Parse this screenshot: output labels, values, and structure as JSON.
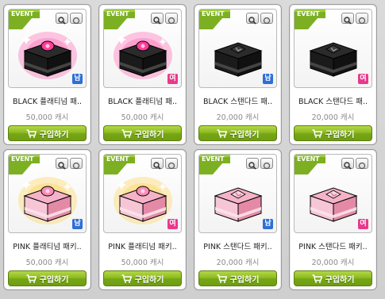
{
  "event_badge": "EVENT",
  "buy_label": "구입하기",
  "items": [
    {
      "name": "BLACK 플래티넘 패..",
      "price": "50,000 캐시",
      "gender": "남",
      "gender_color": "#2f6fd6",
      "color": "black",
      "tier": "platinum"
    },
    {
      "name": "BLACK 플래티넘 패..",
      "price": "50,000 캐시",
      "gender": "여",
      "gender_color": "#e8398d",
      "color": "black",
      "tier": "platinum"
    },
    {
      "name": "BLACK 스탠다드 패..",
      "price": "20,000 캐시",
      "gender": "남",
      "gender_color": "#2f6fd6",
      "color": "black",
      "tier": "standard"
    },
    {
      "name": "BLACK 스탠다드 패..",
      "price": "20,000 캐시",
      "gender": "여",
      "gender_color": "#e8398d",
      "color": "black",
      "tier": "standard"
    },
    {
      "name": "PINK 플래티넘 패키..",
      "price": "50,000 캐시",
      "gender": "남",
      "gender_color": "#2f6fd6",
      "color": "pink",
      "tier": "platinum"
    },
    {
      "name": "PINK 플래티넘 패키..",
      "price": "50,000 캐시",
      "gender": "여",
      "gender_color": "#e8398d",
      "color": "pink",
      "tier": "platinum"
    },
    {
      "name": "PINK 스탠다드 패키..",
      "price": "20,000 캐시",
      "gender": "남",
      "gender_color": "#2f6fd6",
      "color": "pink",
      "tier": "standard"
    },
    {
      "name": "PINK 스탠다드 패키..",
      "price": "20,000 캐시",
      "gender": "여",
      "gender_color": "#e8398d",
      "color": "pink",
      "tier": "standard"
    }
  ],
  "colors": {
    "buy_button": "#7fae1a",
    "event_badge": "#7cb022",
    "male_badge": "#2f6fd6",
    "female_badge": "#e8398d"
  },
  "icons": {
    "zoom": "magnifier-icon",
    "min": "minimize-icon",
    "cart": "cart-icon"
  }
}
